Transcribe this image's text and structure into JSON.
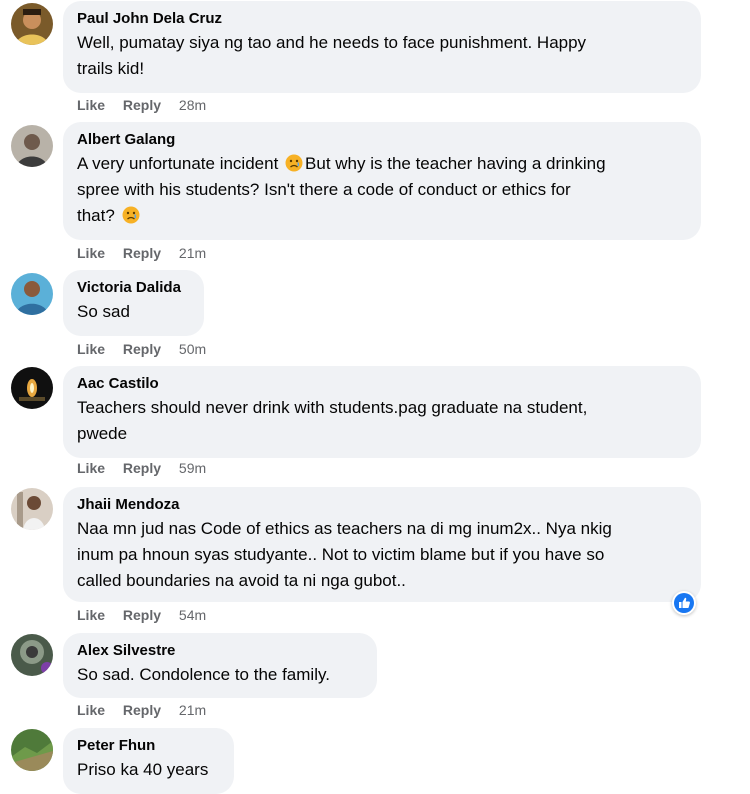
{
  "actions": {
    "like": "Like",
    "reply": "Reply"
  },
  "comments": [
    {
      "name": "Paul John Dela Cruz",
      "lines": [
        "Well, pumatay siya ng tao and he needs to face punishment. Happy",
        "trails kid!"
      ],
      "time": "28m"
    },
    {
      "name": "Albert Galang",
      "lines": [
        "A very unfortunate incident",
        "But why is the teacher having a drinking",
        "spree with his students? Isn't there a code of conduct or ethics for",
        "that?"
      ],
      "time": "21m"
    },
    {
      "name": "Victoria Dalida",
      "lines": [
        "So sad"
      ],
      "time": "50m"
    },
    {
      "name": "Aac Castilo",
      "lines": [
        "Teachers should never drink with students.pag graduate na student,",
        "pwede"
      ],
      "time": "59m"
    },
    {
      "name": "Jhaii Mendoza",
      "lines": [
        "Naa mn jud nas Code of ethics as teachers na di mg inum2x.. Nya nkig",
        "inum pa hnoun syas studyante.. Not to victim blame but if you have so",
        "called boundaries na avoid ta ni nga gubot.."
      ],
      "time": "54m",
      "reaction": "like-icon"
    },
    {
      "name": "Alex Silvestre",
      "lines": [
        "So sad. Condolence to the family."
      ],
      "time": "21m"
    },
    {
      "name": "Peter Fhun",
      "lines": [
        "Priso ka 40 years"
      ],
      "time": ""
    }
  ],
  "colors": {
    "bubble": "#f0f2f5",
    "meta": "#65676b",
    "text": "#050505",
    "like_blue": "#1877f2",
    "sad_emoji": "#f7b125"
  }
}
